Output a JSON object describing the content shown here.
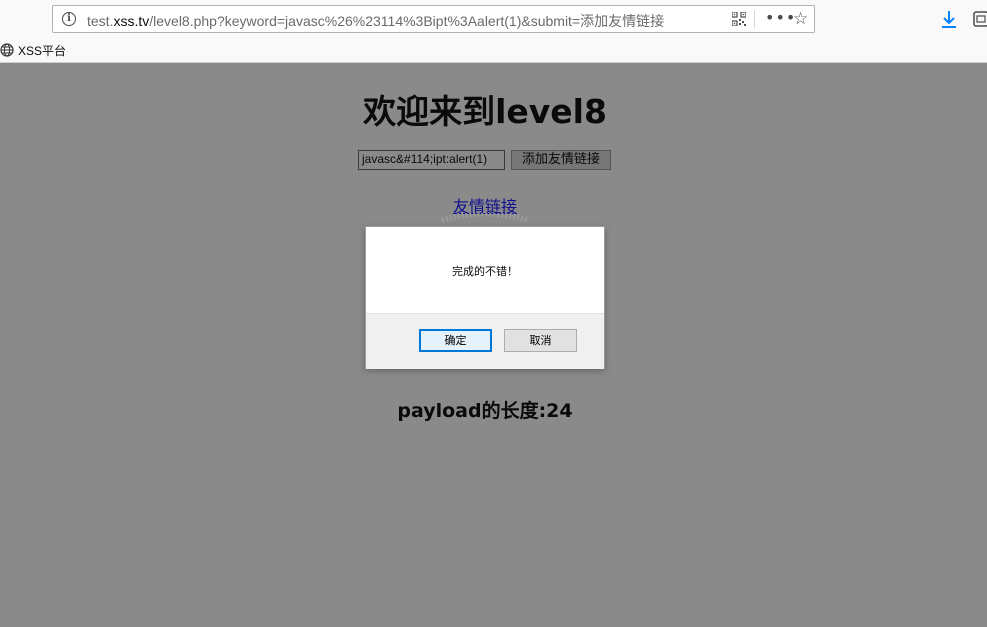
{
  "browser": {
    "url_prefix": "test.",
    "url_host": "xss.tv",
    "url_rest": "/level8.php?keyword=javasc%26%23114%3Bipt%3Aalert(1)&submit=添加友情链接",
    "bookmark_label": "XSS平台",
    "icons": [
      "info-icon",
      "qr-code-icon",
      "more-icon",
      "star-icon",
      "download-icon",
      "library-icon",
      "globe-icon"
    ]
  },
  "page": {
    "title": "欢迎来到level8",
    "keyword_value": "javasc&#114;ipt:alert(1)",
    "submit_label": "添加友情链接",
    "friend_link_label": "友情链接",
    "payload_label": "payload的长度:",
    "payload_length": "24"
  },
  "dialog": {
    "message": "完成的不错！",
    "ok_label": "确定",
    "cancel_label": "取消"
  },
  "colors": {
    "overlay_background": "#8a8a8a",
    "link": "#0e0e8e",
    "dialog_focus": "#0078d7"
  }
}
